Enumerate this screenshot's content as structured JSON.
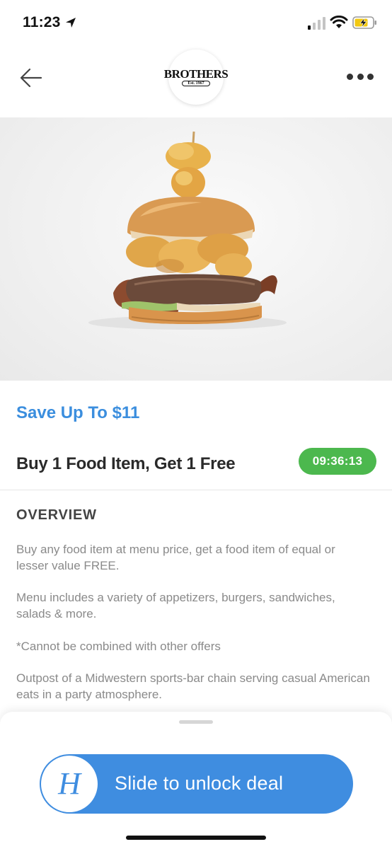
{
  "status_bar": {
    "time": "11:23",
    "icons": [
      "location-arrow-icon",
      "cellular-signal-icon",
      "wifi-icon",
      "battery-charging-icon"
    ]
  },
  "header": {
    "back_icon": "back-arrow-icon",
    "logo_text": "BROTHERS",
    "logo_subtext": "Est. 1967",
    "more_icon": "more-dots-icon"
  },
  "hero": {
    "image": "burger-photo"
  },
  "deal": {
    "savings": "Save Up To $11",
    "title": "Buy 1 Food Item, Get 1 Free",
    "timer": "09:36:13"
  },
  "overview": {
    "heading": "OVERVIEW",
    "paragraphs": [
      "Buy any food item at menu price, get a food item of equal or lesser value FREE.",
      "Menu includes a variety of appetizers, burgers, sandwiches, salads & more.",
      "*Cannot be combined with other offers",
      "Outpost of a Midwestern sports-bar chain serving casual American eats in a party atmosphere."
    ]
  },
  "unlock": {
    "knob_glyph": "H",
    "label": "Slide to unlock deal"
  },
  "colors": {
    "accent_blue": "#3f8de0",
    "savings_blue": "#3b8ede",
    "timer_green": "#4cb84e",
    "body_gray": "#8a8a8a"
  }
}
